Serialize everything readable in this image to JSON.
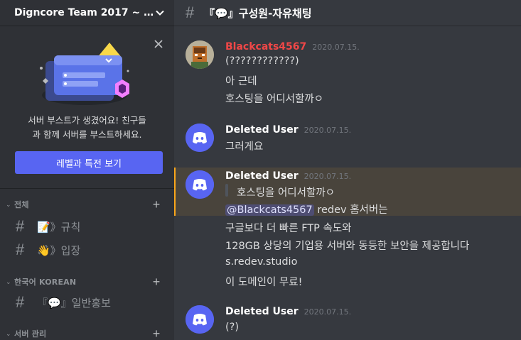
{
  "server": {
    "name": "Digncore Team 2017 ~ 2..."
  },
  "boost": {
    "text_line1": "서버 부스트가 생겼어요! 친구들",
    "text_line2": "과 함께 서버를 부스트하세요.",
    "button": "레벨과 특전 보기"
  },
  "categories": [
    {
      "label": "전체",
      "channels": [
        "📝》규칙",
        "👋》입장"
      ]
    },
    {
      "label": "한국어 KOREAN",
      "channels": [
        "『💬』일반홍보"
      ]
    },
    {
      "label": "서버 관리",
      "channels": []
    }
  ],
  "channel": {
    "title": "『💬』구성원-자유채팅"
  },
  "messages": [
    {
      "author": "Blackcats4567",
      "author_color": "#f04747",
      "timestamp": "2020.07.15.",
      "lines": [
        "(????????????)",
        "아 근데",
        "호스팅을 어디서할까ㅇ"
      ]
    },
    {
      "author": "Deleted User",
      "author_color": "#ffffff",
      "timestamp": "2020.07.15.",
      "lines": [
        "그러게요"
      ]
    },
    {
      "author": "Deleted User",
      "author_color": "#ffffff",
      "timestamp": "2020.07.15.",
      "quote": "호스팅을 어디서할까ㅇ",
      "mention": "@Blackcats4567",
      "mention_rest": " redev 홈서버는",
      "lines": [
        "구글보다 더 빠른 FTP 속도와",
        "128GB 상당의 기업용 서버와 동등한 보안을 제공합니다",
        "s.redev.studio",
        "이 도메인이 무료!"
      ]
    },
    {
      "author": "Deleted User",
      "author_color": "#ffffff",
      "timestamp": "2020.07.15.",
      "lines": [
        "(?)"
      ]
    }
  ],
  "colors": {
    "accent": "#5865f2",
    "highlight_border": "#faa61a",
    "discord_avatar": "#5865f2"
  }
}
